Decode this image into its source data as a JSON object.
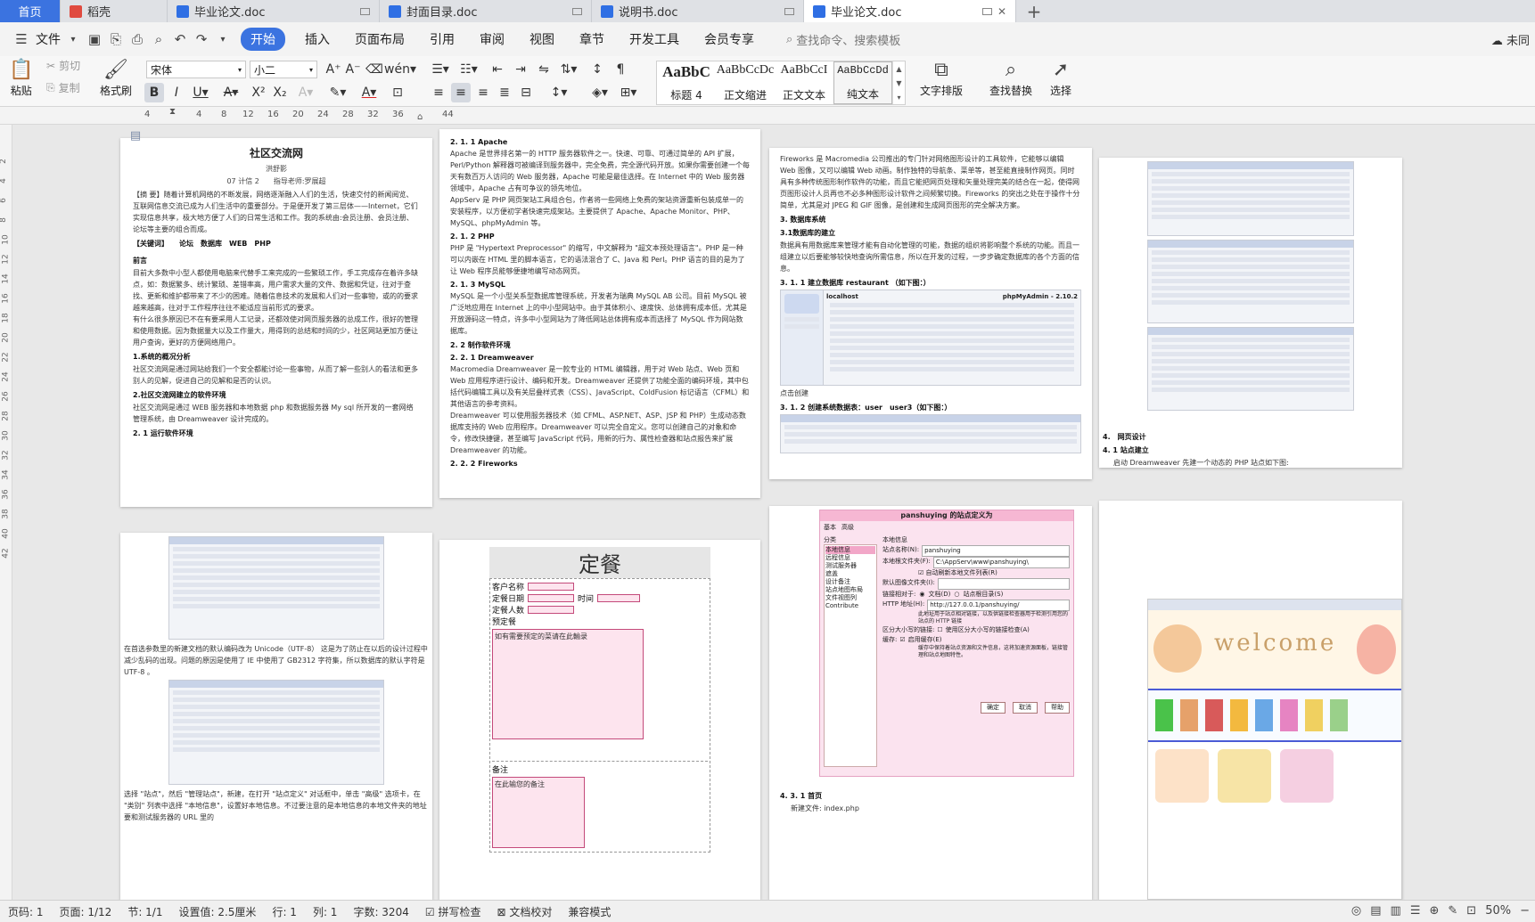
{
  "tabs": [
    {
      "label": "首页",
      "type": "home"
    },
    {
      "label": "稻壳",
      "type": "docer"
    },
    {
      "label": "毕业论文.doc",
      "type": "doc"
    },
    {
      "label": "封面目录.doc",
      "type": "doc"
    },
    {
      "label": "说明书.doc",
      "type": "doc"
    },
    {
      "label": "毕业论文.doc",
      "type": "doc",
      "active": true
    }
  ],
  "menu": {
    "file": "文件",
    "items": [
      "开始",
      "插入",
      "页面布局",
      "引用",
      "审阅",
      "视图",
      "章节",
      "开发工具",
      "会员专享"
    ],
    "active": "开始",
    "search": "查找命令、搜索模板",
    "right": "未同"
  },
  "ribbon": {
    "paste": "粘贴",
    "cut": "剪切",
    "copy": "复制",
    "format_painter": "格式刷",
    "font_name": "宋体",
    "font_size": "小二",
    "styles": [
      {
        "preview": "AaBbC",
        "label": "标题 4"
      },
      {
        "preview": "AaBbCcDc",
        "label": "正文缩进"
      },
      {
        "preview": "AaBbCcI",
        "label": "正文文本"
      },
      {
        "preview": "AaBbCcDd",
        "label": "纯文本"
      }
    ],
    "text_layout": "文字排版",
    "find_replace": "查找替换",
    "select": "选择"
  },
  "ruler": {
    "ticks": [
      "4",
      "4",
      "8",
      "12",
      "16",
      "20",
      "24",
      "28",
      "32",
      "36",
      "44"
    ]
  },
  "vruler": {
    "ticks": [
      "2",
      "4",
      "6",
      "8",
      "10",
      "12",
      "14",
      "16",
      "18",
      "20",
      "22",
      "24",
      "26",
      "28",
      "30",
      "32",
      "34",
      "36",
      "38",
      "40",
      "42"
    ]
  },
  "pages": {
    "p1": {
      "title": "社区交流网",
      "author": "洪舒影",
      "meta": "07 计信 2　　指导老师:罗展超",
      "abstract": "【摘 要】随着计算机网络的不断发展，网络逐渐融入人们的生活，快速交付的新闻阅览、互联网信息交流已成为人们生活中的重要部分。于是便开发了第三层体——Internet，它们实现信息共享，极大地方便了人们的日常生活和工作。我的系统由:会员注册、会员注册、论坛等主要的组合而成。",
      "keywords": "【关键词】　　论坛　数据库　WEB　PHP",
      "intro_h": "前言",
      "intro": "目前大多数中小型人都使用电脑来代替手工来完成的一些繁琐工作，手工完成存在着许多缺点，如：数据繁多、统计繁琐、差错率高，用户需求大量的文件、数据和凭证，往对于查找、更新和维护都带来了不少的困难。随着信息技术的发展和人们对一些事物，或的的要求越来越高，往对于工作程序往往不能适应当前形式的要求。",
      "intro2": "有什么很多原因已不在有要采用人工记录，还都效使对网页服务器的总成工作，很好的管理和使用数据。因为数据量大以及工作量大，用得到的总结和时间的少，社区网站更加方便让用户查询，更好的方便网络用户。",
      "s1": "1.系统的概况分析",
      "s1t": "社区交流网是通过网站给我们一个安全都能讨论一些事物，从而了解一些别人的看法和更多别人的见解，促进自己的见解和是否的认识。",
      "s2": "2.社区交流网建立的软件环境",
      "s2t": "社区交流网是通过 WEB 服务器和本地数据 php 和数据服务器 My sql 所开发的一套网络管理系统，由 Dreamweaver 设计完成的。",
      "s21": "2. 1 运行软件环境"
    },
    "p2": {
      "h1": "2. 1. 1 Apache",
      "t1": "Apache 是世界排名第一的 HTTP 服务器软件之一。快速、可靠、可通过简单的 API 扩展，Perl/Python 解释器可被编译到服务器中，完全免费，完全源代码开放。如果你需要创建一个每天有数百万人访问的 Web 服务器，Apache 可能是最佳选择。在 Internet 中的 Web 服务器领域中，Apache 占有可争议的领先地位。",
      "t1b": "AppServ 是 PHP 网页架站工具组合包，作者将一些网络上免费的架站资源重新包装成单一的安装程序，以方便初学者快速完成架站。主要提供了 Apache、Apache Monitor、PHP、MySQL、phpMyAdmin 等。",
      "h2": "2. 1. 2 PHP",
      "t2": "PHP 是 \"Hypertext Preprocessor\" 的缩写，中文解释为 \"超文本预处理语言\"。PHP 是一种可以内嵌在 HTML 里的脚本语言，它的语法混合了 C、Java 和 Perl。PHP 语言的目的是为了让 Web 程序员能够便捷地编写动态网页。",
      "h3": "2. 1. 3 MySQL",
      "t3": "MySQL 是一个小型关系型数据库管理系统，开发者为瑞典 MySQL AB 公司。目前 MySQL 被广泛地应用在 Internet 上的中小型网站中。由于其体积小、速度快、总体拥有成本低，尤其是开放源码这一特点，许多中小型网站为了降低网站总体拥有成本而选择了 MySQL 作为网站数据库。",
      "h4": "2. 2 制作软件环境",
      "h5": "2. 2. 1 Dreamweaver",
      "t5": "Macromedia Dreamweaver 是一款专业的 HTML 编辑器，用于对 Web 站点、Web 页和 Web 应用程序进行设计、编码和开发。Dreamweaver 还提供了功能全面的编码环境，其中包括代码编辑工具以及有关层叠样式表（CSS）、JavaScript、ColdFusion 标记语言（CFML）和其他语言的参考资料。",
      "t5b": "Dreamweaver 可以使用服务器技术（如 CFML、ASP.NET、ASP、JSP 和 PHP）生成动态数据库支持的 Web 应用程序。Dreamweaver 可以完全自定义。您可以创建自己的对象和命令，修改快捷键，甚至编写 JavaScript 代码，用新的行为、属性检查器和站点报告来扩展 Dreamweaver 的功能。",
      "h6": "2. 2. 2 Fireworks"
    },
    "p3": {
      "t1": "Fireworks 是 Macromedia 公司推出的专门针对网络图形设计的工具软件，它能够以编辑 Web 图像，又可以编辑 Web 动画。制作独特的导航条、菜单等，甚至能直接制作网页。同时具有多种传统图形制作软件的功能，而且它能把网页处理和矢量处理完美的结合在一起，使得网页图形设计人员再也不必多种图形设计软件之间频繁切换。Fireworks 的突出之处在于操作十分简单，尤其是对 JPEG 和 GIF 图像，是创建和生成网页图形的完全解决方案。",
      "h1": "3. 数据库系统",
      "h2": "3.1数据库的建立",
      "t2": "数据具有用数据库来管理才能有自动化管理的可能，数据的组织将影响整个系统的功能。而且一组建立以后要能够较快地查询所需信息，所以在开发的过程，一步步确定数据库的各个方面的信息。",
      "h3": "3. 1. 1 建立数据库 restaurant （如下图：）",
      "shot_title": "phpMyAdmin - 2.10.2",
      "shot_host": "localhost",
      "cap1": "点击创建",
      "h4": "3. 1. 2 创建系统数据表：user　user3（如下图：）"
    },
    "p4": {
      "h1": "4.　网页设计",
      "h2": "4. 1 站点建立",
      "t2": "启动 Dreamweaver 先建一个动态的 PHP 站点如下图:"
    },
    "p5": {
      "t1": "在首选参数里的新建文档的默认编码改为 Unicode（UTF-8） 这是为了防止在以后的设计过程中减少乱码的出现。问题的原因是使用了 IE 中使用了 GB2312 字符集，所以数据库的默认字符是 UTF-8 。",
      "t2": "选择 \"站点\"，然后 \"管理站点\"，新建，在打开 \"站点定义\" 对话框中，单击 \"高级\" 选项卡，在 \"类别\" 列表中选择 \"本地信息\"，设置好本地信息。不过要注意的是本地信息的本地文件夹的地址要和测试服务器的 URL 里的"
    },
    "p6": {
      "title": "定餐",
      "l1": "客户名称",
      "l2": "定餐日期",
      "l2b": "时间",
      "l3": "定餐人数",
      "l4": "预定餐",
      "box1": "如有需要预定的菜请在此輸录",
      "l5": "备注",
      "box2": "在此输您的备注"
    },
    "p7": {
      "dlg_title": "panshuying 的站点定义为",
      "tabs": [
        "基本",
        "高级"
      ],
      "cat": "分类",
      "cats": [
        "本地信息",
        "远程信息",
        "测试服务器",
        "遮盖",
        "设计备注",
        "站点地图布局",
        "文件视图列",
        "Contribute"
      ],
      "sec": "本地信息",
      "f1": "站点名称(N):",
      "v1": "panshuying",
      "f2": "本地根文件夹(F):",
      "v2": "C:\\AppServ\\www\\panshuying\\",
      "c1": "自动刷新本地文件列表(R)",
      "f3": "默认图像文件夹(I):",
      "f4": "链接相对于:",
      "r1": "文档(D)",
      "r2": "站点根目录(S)",
      "f5": "HTTP 地址(H):",
      "v5": "http://127.0.0.1/panshuying/",
      "note": "此地址用于站点相对链接，以及供链接检查器用于检测引用您的站点的 HTTP 链接",
      "f6": "区分大小写的链接:",
      "c2": "使用区分大小写的链接检查(A)",
      "f7": "缓存:",
      "c3": "启用缓存(E)",
      "note2": "缓存中保持着站点资源和文件信息，这将加速资源面板，链接管理和站点地图特性。",
      "b1": "确定",
      "b2": "取消",
      "b3": "帮助",
      "h1": "4. 3. 1 首页",
      "t1": "新建文件: index.php"
    },
    "p8": {
      "banner": "welcome"
    }
  },
  "status": {
    "page": "页码: 1",
    "pages": "页面: 1/12",
    "section": "节: 1/1",
    "setting": "设置值: 2.5厘米",
    "row": "行: 1",
    "col": "列: 1",
    "words": "字数: 3204",
    "spell": "拼写检查",
    "proof": "文档校对",
    "compat": "兼容模式",
    "zoom": "50%"
  }
}
